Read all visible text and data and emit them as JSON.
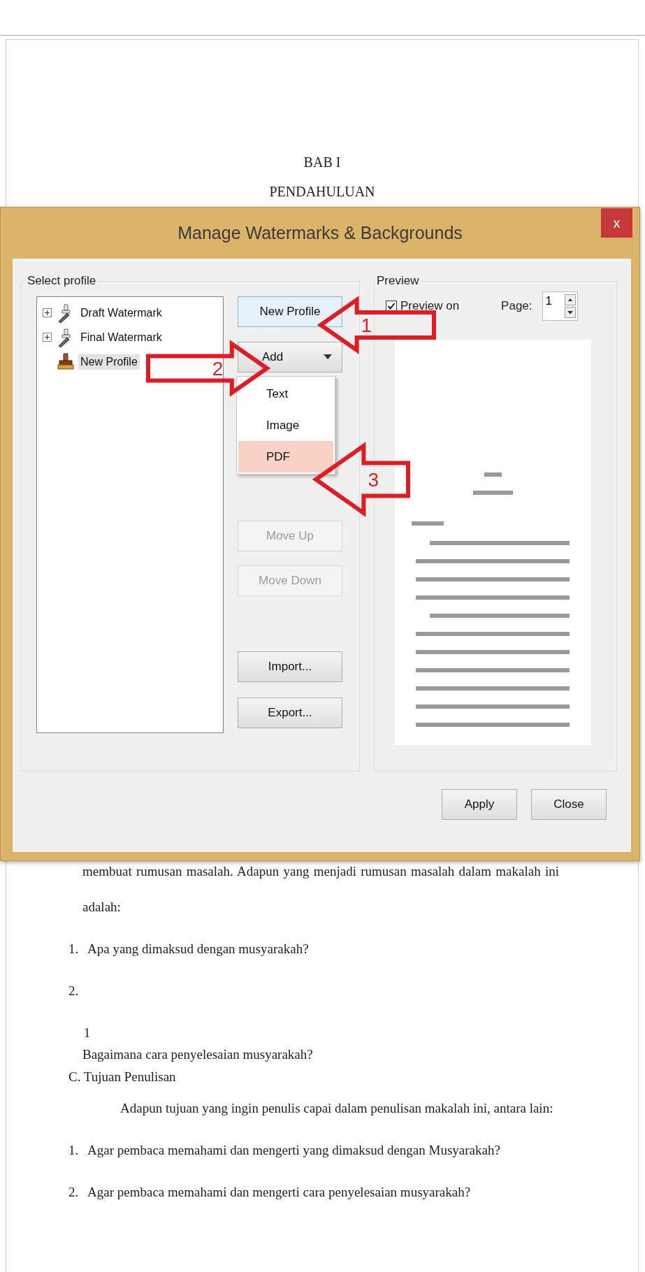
{
  "document": {
    "heading": [
      "BAB I",
      "PENDAHULUAN"
    ],
    "lines": [
      {
        "kind": "para",
        "text": "membuat rumusan masalah. Adapun yang menjadi rumusan masalah dalam makalah ini"
      },
      {
        "kind": "cont",
        "text": "adalah:"
      },
      {
        "kind": "item",
        "number": "1.",
        "text": "Apa yang dimaksud dengan musyarakah?"
      },
      {
        "kind": "item",
        "number": "2."
      },
      {
        "kind": "note",
        "text": "1"
      },
      {
        "kind": "tight",
        "text": "Bagaimana cara penyelesaian musyarakah?"
      },
      {
        "kind": "section",
        "text": "C. Tujuan Penulisan"
      },
      {
        "kind": "indent",
        "text": "Adapun tujuan yang ingin penulis capai dalam penulisan makalah ini, antara lain:"
      },
      {
        "kind": "item",
        "number": "1.",
        "text": "Agar pembaca memahami dan mengerti yang dimaksud dengan Musyarakah?"
      },
      {
        "kind": "item",
        "number": "2.",
        "text": "Agar pembaca memahami dan mengerti cara penyelesaian musyarakah?"
      }
    ]
  },
  "dialog": {
    "title": "Manage Watermarks & Backgrounds",
    "close": "x",
    "select_profile": {
      "label": "Select profile",
      "tree": [
        {
          "label": "Draft Watermark",
          "kind": "preset",
          "expanded": false,
          "selected": false
        },
        {
          "label": "Final Watermark",
          "kind": "preset",
          "expanded": false,
          "selected": false
        },
        {
          "label": "New Profile",
          "kind": "custom",
          "selected": true
        }
      ],
      "buttons": [
        {
          "label": "New Profile",
          "kind": "button",
          "focused": true,
          "disabled": false
        },
        {
          "label": "Add",
          "kind": "dropdown",
          "focused": false,
          "disabled": false,
          "menu": [
            {
              "label": "Text",
              "selected": false
            },
            {
              "label": "Image",
              "selected": false
            },
            {
              "label": "PDF",
              "selected": true
            }
          ]
        },
        {
          "label": "Move Up",
          "kind": "button",
          "focused": false,
          "disabled": true
        },
        {
          "label": "Move Down",
          "kind": "button",
          "focused": false,
          "disabled": true
        },
        {
          "label": "Import...",
          "kind": "button",
          "focused": false,
          "disabled": false
        },
        {
          "label": "Export...",
          "kind": "button",
          "focused": false,
          "disabled": false
        }
      ]
    },
    "preview": {
      "label": "Preview",
      "preview_on": {
        "label": "Preview on",
        "checked": true
      },
      "page_label": "Page:",
      "page": "1"
    },
    "footer": [
      "Apply",
      "Close"
    ]
  },
  "annotations": [
    {
      "number": "1",
      "kind": "left"
    },
    {
      "number": "2",
      "kind": "right"
    },
    {
      "number": "3",
      "kind": "left"
    }
  ]
}
